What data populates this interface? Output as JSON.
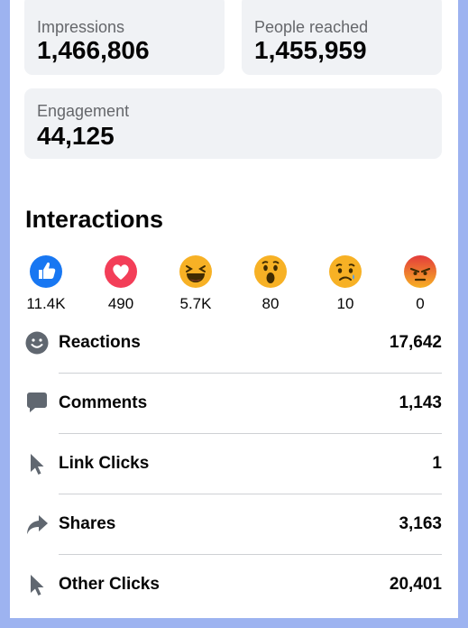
{
  "summary": {
    "impressions": {
      "label": "Impressions",
      "value": "1,466,806"
    },
    "people_reached": {
      "label": "People reached",
      "value": "1,455,959"
    },
    "engagement": {
      "label": "Engagement",
      "value": "44,125"
    }
  },
  "interactions": {
    "title": "Interactions",
    "reactions": [
      {
        "icon": "like-icon",
        "count": "11.4K"
      },
      {
        "icon": "love-icon",
        "count": "490"
      },
      {
        "icon": "haha-icon",
        "count": "5.7K"
      },
      {
        "icon": "wow-icon",
        "count": "80"
      },
      {
        "icon": "sad-icon",
        "count": "10"
      },
      {
        "icon": "angry-icon",
        "count": "0"
      }
    ],
    "stats": [
      {
        "icon": "smiley-icon",
        "label": "Reactions",
        "value": "17,642"
      },
      {
        "icon": "comment-icon",
        "label": "Comments",
        "value": "1,143"
      },
      {
        "icon": "cursor-icon",
        "label": "Link Clicks",
        "value": "1"
      },
      {
        "icon": "share-icon",
        "label": "Shares",
        "value": "3,163"
      },
      {
        "icon": "cursor-icon",
        "label": "Other Clicks",
        "value": "20,401"
      }
    ]
  },
  "colors": {
    "like": "#1877f2",
    "love": "#f33e58",
    "emoji_yellow": "#f7b125",
    "angry_red": "#e9710f",
    "icon_gray": "#606770"
  }
}
